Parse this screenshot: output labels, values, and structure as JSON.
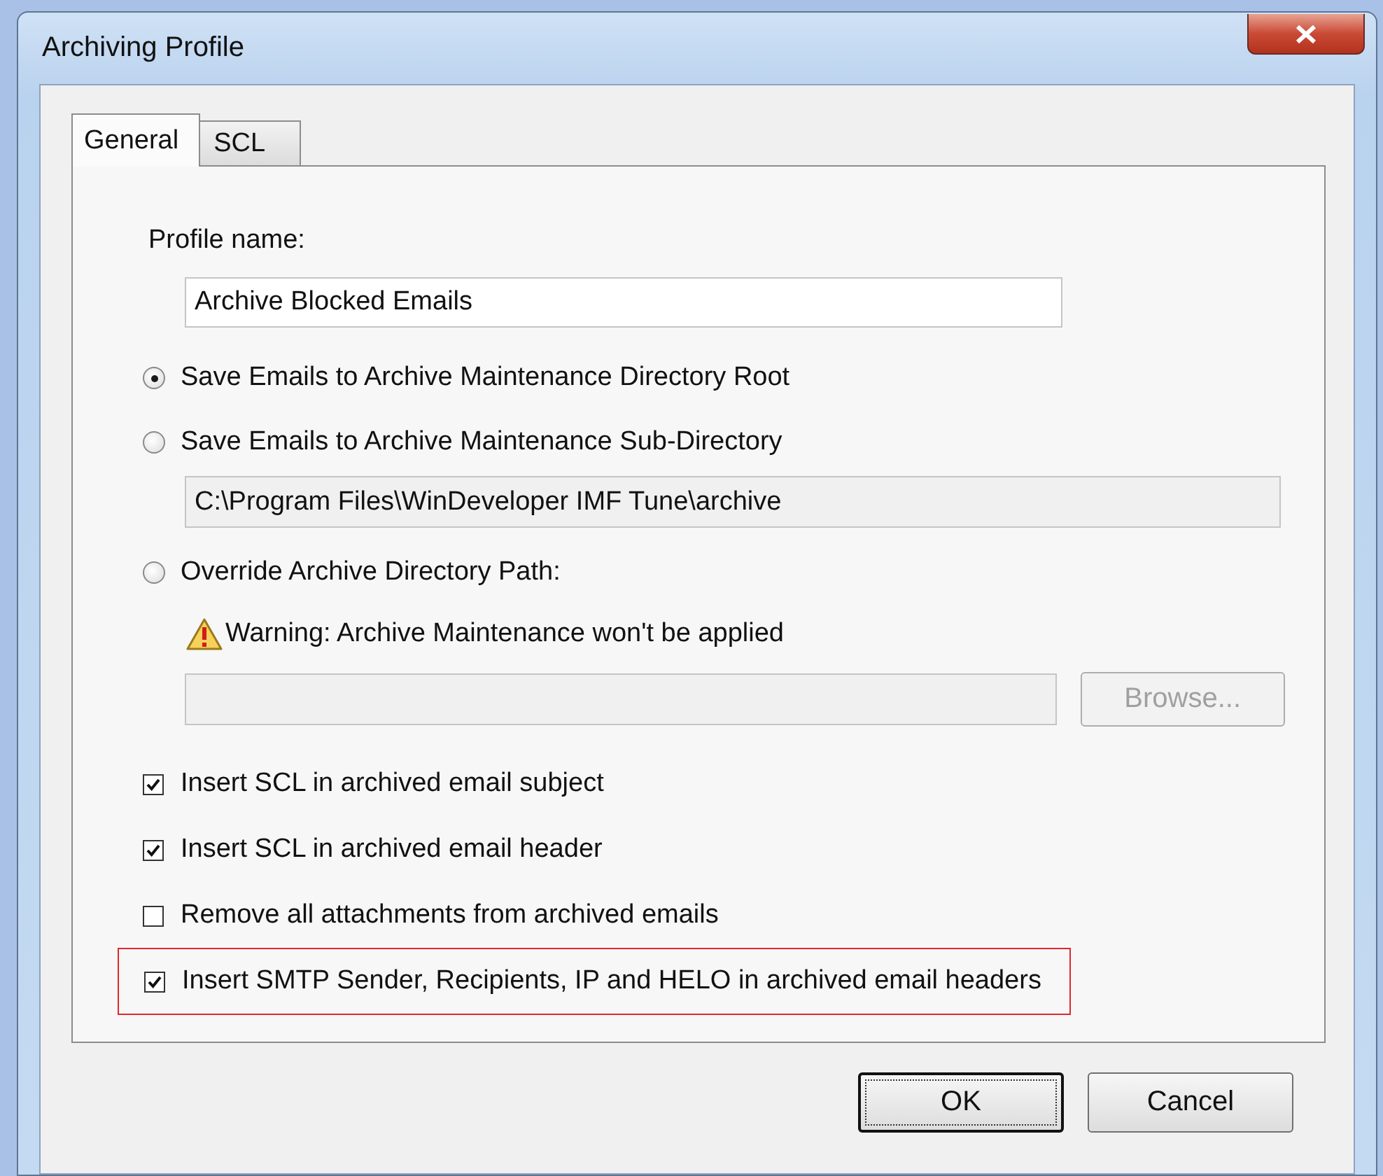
{
  "window": {
    "title": "Archiving Profile"
  },
  "tabs": [
    {
      "label": "General",
      "selected": true
    },
    {
      "label": "SCL",
      "selected": false
    }
  ],
  "profile_name": {
    "label": "Profile name:",
    "value": "Archive Blocked Emails"
  },
  "save_options": [
    {
      "label": "Save Emails to Archive Maintenance Directory Root",
      "selected": true
    },
    {
      "label": "Save Emails to Archive Maintenance Sub-Directory",
      "selected": false,
      "path": {
        "value": "C:\\Program Files\\WinDeveloper IMF Tune\\archive",
        "disabled": true
      }
    },
    {
      "label": "Override Archive Directory Path:",
      "selected": false,
      "warning": "Warning: Archive Maintenance won't be applied",
      "path": {
        "disabled": true
      },
      "browse": {
        "label": "Browse...",
        "disabled": true
      }
    }
  ],
  "checkboxes": [
    {
      "label": "Insert SCL in archived email subject",
      "checked": true,
      "highlighted": false
    },
    {
      "label": "Insert SCL in archived email header",
      "checked": true,
      "highlighted": false
    },
    {
      "label": "Remove all attachments from archived emails",
      "checked": false,
      "highlighted": false
    },
    {
      "label": "Insert SMTP Sender, Recipients, IP and HELO in archived email headers",
      "checked": true,
      "highlighted": true
    }
  ],
  "buttons": [
    {
      "label": "OK",
      "default": true
    },
    {
      "label": "Cancel",
      "default": false
    }
  ]
}
